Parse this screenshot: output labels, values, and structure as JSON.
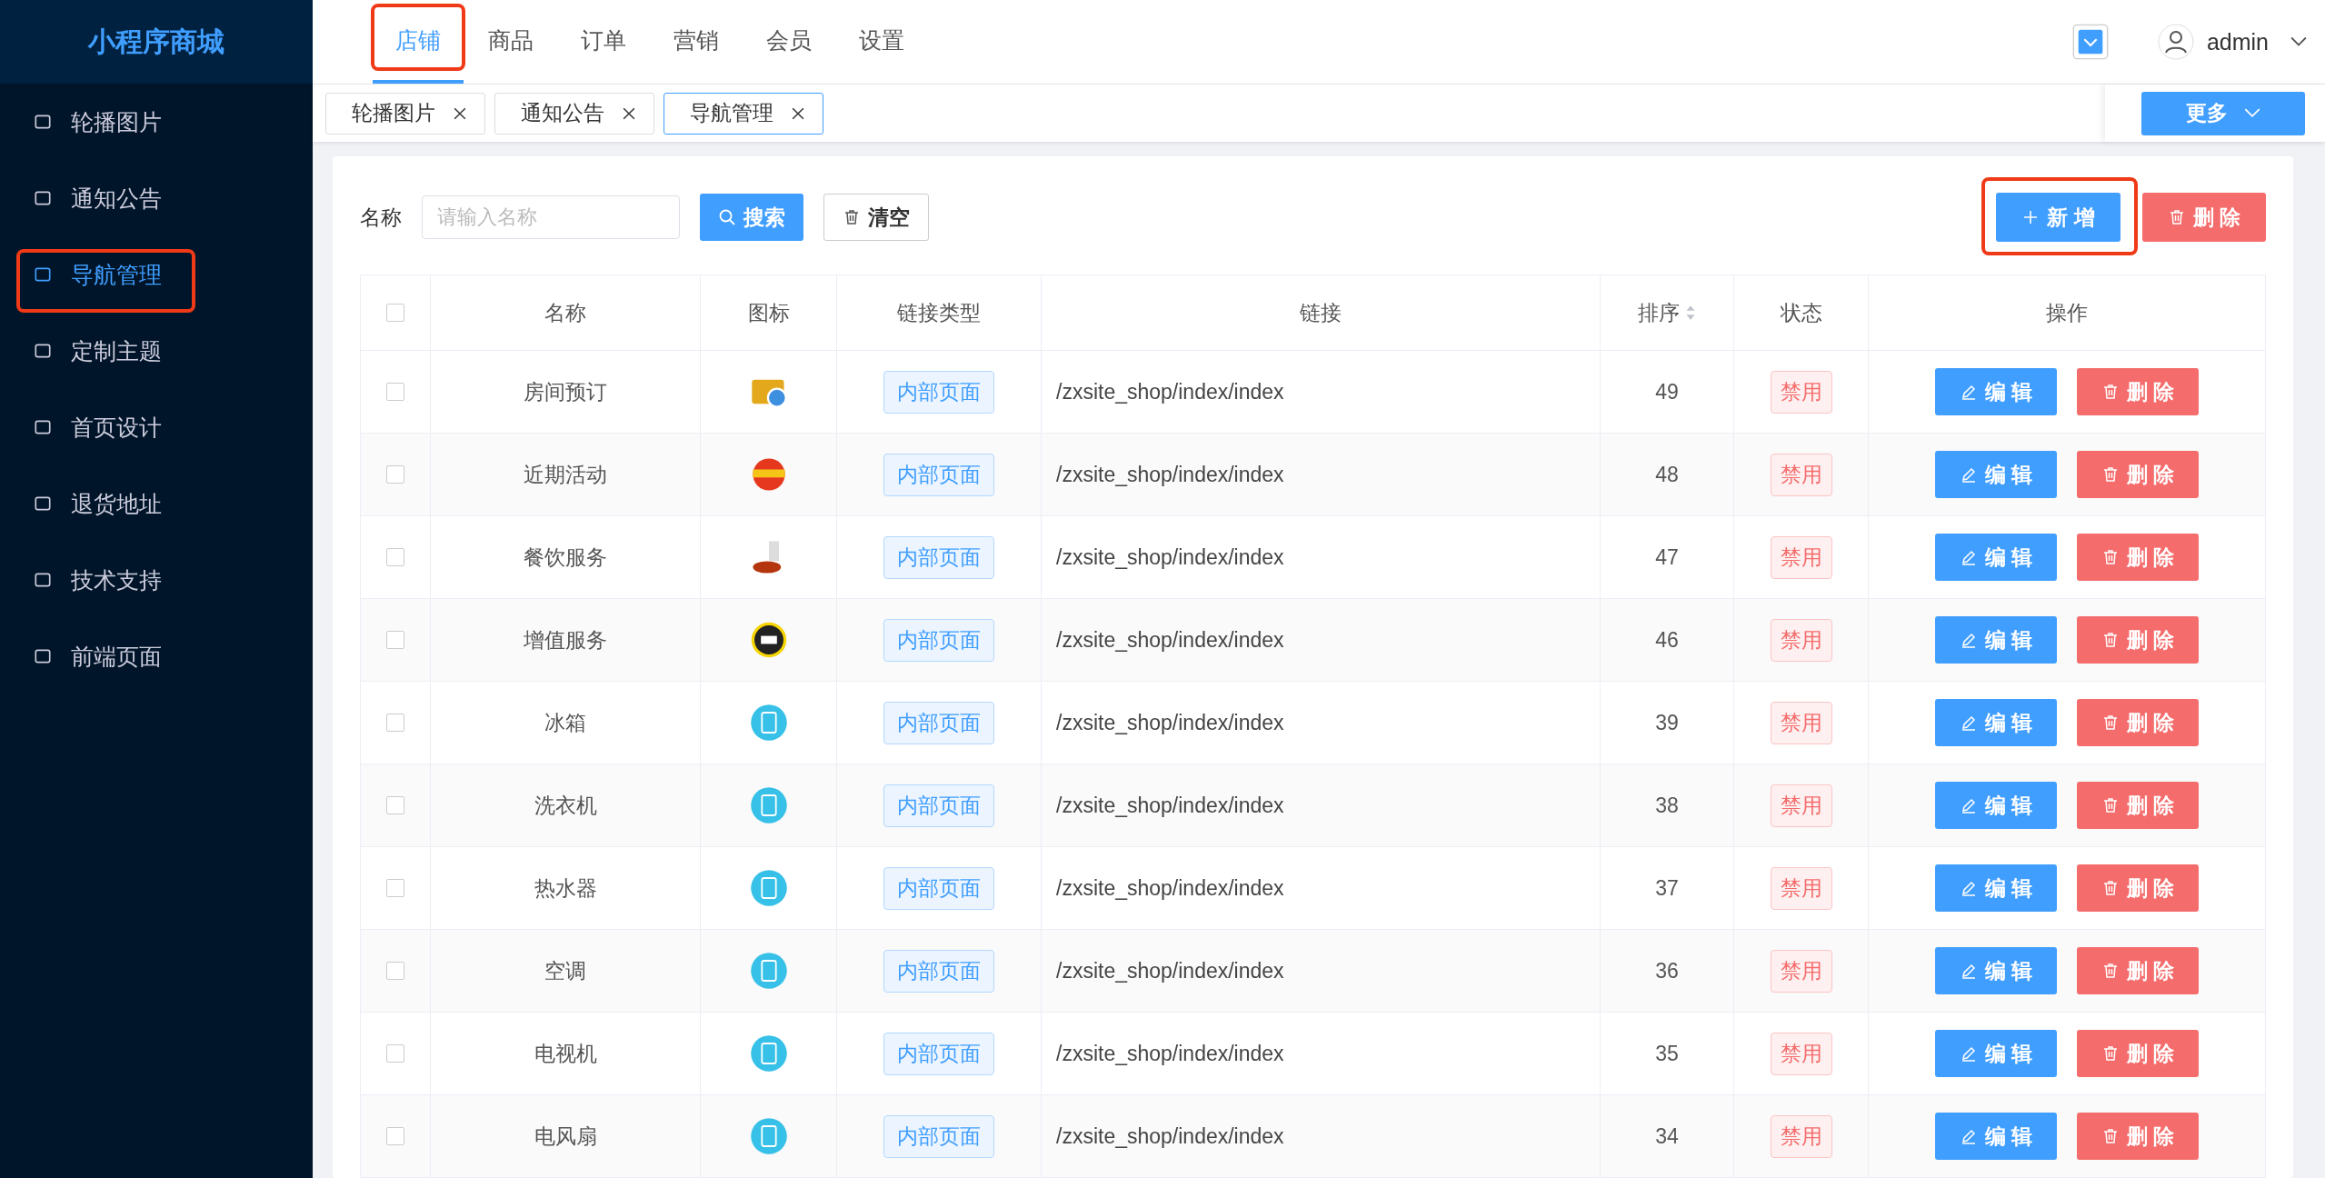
{
  "sidebar": {
    "title": "小程序商城",
    "items": [
      {
        "label": "轮播图片",
        "selected": false
      },
      {
        "label": "通知公告",
        "selected": false
      },
      {
        "label": "导航管理",
        "selected": true
      },
      {
        "label": "定制主题",
        "selected": false
      },
      {
        "label": "首页设计",
        "selected": false
      },
      {
        "label": "退货地址",
        "selected": false
      },
      {
        "label": "技术支持",
        "selected": false
      },
      {
        "label": "前端页面",
        "selected": false
      }
    ]
  },
  "top_nav": [
    {
      "label": "店铺",
      "selected": true
    },
    {
      "label": "商品",
      "selected": false
    },
    {
      "label": "订单",
      "selected": false
    },
    {
      "label": "营销",
      "selected": false
    },
    {
      "label": "会员",
      "selected": false
    },
    {
      "label": "设置",
      "selected": false
    }
  ],
  "user": {
    "name": "admin"
  },
  "open_tabs": [
    {
      "label": "轮播图片",
      "selected": false
    },
    {
      "label": "通知公告",
      "selected": false
    },
    {
      "label": "导航管理",
      "selected": true
    }
  ],
  "more_button": "更多",
  "filter": {
    "label": "名称",
    "placeholder": "请输入名称",
    "search_button": "搜索",
    "clear_button": "清空"
  },
  "actions": {
    "add_button": "新 增",
    "delete_button": "删 除"
  },
  "table": {
    "header_checked": false,
    "columns": [
      "名称",
      "图标",
      "链接类型",
      "链接",
      "排序",
      "状态",
      "操作"
    ],
    "rows": [
      {
        "checked": false,
        "name": "房间预订",
        "link_type": "内部页面",
        "link": "/zxsite_shop/index/index",
        "sort": "49",
        "status": "禁用",
        "edit": "编 辑",
        "delete": "删 除"
      },
      {
        "checked": false,
        "name": "近期活动",
        "link_type": "内部页面",
        "link": "/zxsite_shop/index/index",
        "sort": "48",
        "status": "禁用",
        "edit": "编 辑",
        "delete": "删 除"
      },
      {
        "checked": false,
        "name": "餐饮服务",
        "link_type": "内部页面",
        "link": "/zxsite_shop/index/index",
        "sort": "47",
        "status": "禁用",
        "edit": "编 辑",
        "delete": "删 除"
      },
      {
        "checked": false,
        "name": "增值服务",
        "link_type": "内部页面",
        "link": "/zxsite_shop/index/index",
        "sort": "46",
        "status": "禁用",
        "edit": "编 辑",
        "delete": "删 除"
      },
      {
        "checked": false,
        "name": "冰箱",
        "link_type": "内部页面",
        "link": "/zxsite_shop/index/index",
        "sort": "39",
        "status": "禁用",
        "edit": "编 辑",
        "delete": "删 除"
      },
      {
        "checked": false,
        "name": "洗衣机",
        "link_type": "内部页面",
        "link": "/zxsite_shop/index/index",
        "sort": "38",
        "status": "禁用",
        "edit": "编 辑",
        "delete": "删 除"
      },
      {
        "checked": false,
        "name": "热水器",
        "link_type": "内部页面",
        "link": "/zxsite_shop/index/index",
        "sort": "37",
        "status": "禁用",
        "edit": "编 辑",
        "delete": "删 除"
      },
      {
        "checked": false,
        "name": "空调",
        "link_type": "内部页面",
        "link": "/zxsite_shop/index/index",
        "sort": "36",
        "status": "禁用",
        "edit": "编 辑",
        "delete": "删 除"
      },
      {
        "checked": false,
        "name": "电视机",
        "link_type": "内部页面",
        "link": "/zxsite_shop/index/index",
        "sort": "35",
        "status": "禁用",
        "edit": "编 辑",
        "delete": "删 除"
      },
      {
        "checked": false,
        "name": "电风扇",
        "link_type": "内部页面",
        "link": "/zxsite_shop/index/index",
        "sort": "34",
        "status": "禁用",
        "edit": "编 辑",
        "delete": "删 除"
      }
    ]
  }
}
